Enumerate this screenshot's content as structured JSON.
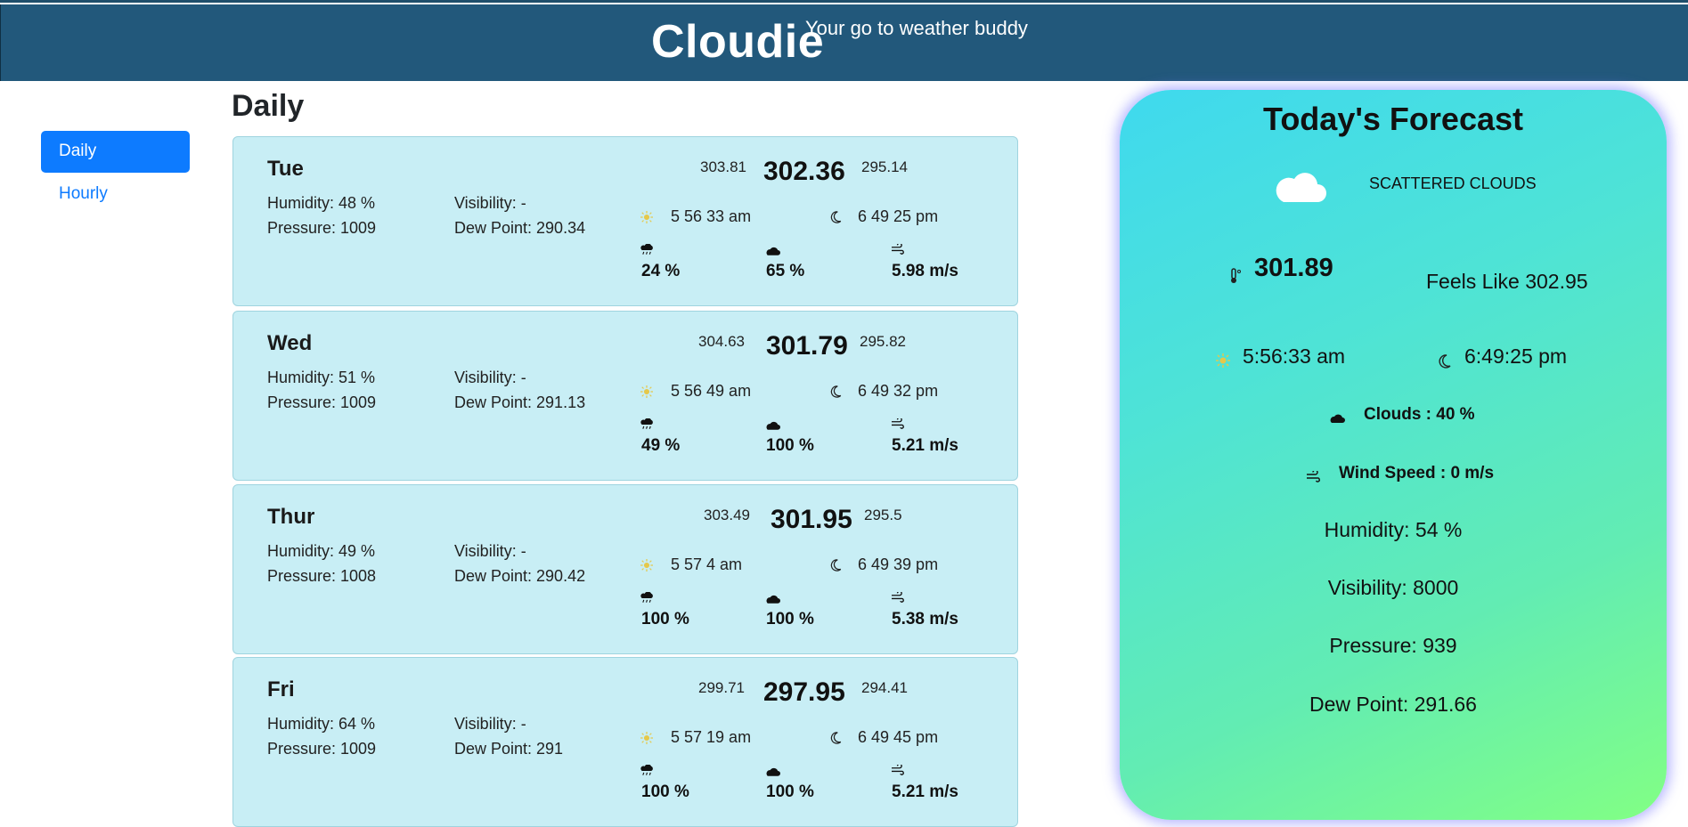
{
  "header": {
    "brand": "Cloudie",
    "tagline": "Your go to weather buddy"
  },
  "sidebar": {
    "items": [
      {
        "label": "Daily",
        "active": true
      },
      {
        "label": "Hourly",
        "active": false
      }
    ]
  },
  "main": {
    "title": "Daily",
    "days": [
      {
        "day": "Tue",
        "humidity": "Humidity: 48 %",
        "pressure": "Pressure: 1009",
        "visibility": "Visibility: -",
        "dew_point": "Dew Point: 290.34",
        "temp_max": "303.81",
        "temp": "302.36",
        "temp_min": "295.14",
        "sunrise": "5 56 33 am",
        "sunset": "6 49 25 pm",
        "rain": "24 %",
        "clouds": "65 %",
        "wind": "5.98 m/s"
      },
      {
        "day": "Wed",
        "humidity": "Humidity: 51 %",
        "pressure": "Pressure: 1009",
        "visibility": "Visibility: -",
        "dew_point": "Dew Point: 291.13",
        "temp_max": "304.63",
        "temp": "301.79",
        "temp_min": "295.82",
        "sunrise": "5 56 49 am",
        "sunset": "6 49 32 pm",
        "rain": "49 %",
        "clouds": "100 %",
        "wind": "5.21 m/s"
      },
      {
        "day": "Thur",
        "humidity": "Humidity: 49 %",
        "pressure": "Pressure: 1008",
        "visibility": "Visibility: -",
        "dew_point": "Dew Point: 290.42",
        "temp_max": "303.49",
        "temp": "301.95",
        "temp_min": "295.5",
        "sunrise": "5 57 4 am",
        "sunset": "6 49 39 pm",
        "rain": "100 %",
        "clouds": "100 %",
        "wind": "5.38 m/s"
      },
      {
        "day": "Fri",
        "humidity": "Humidity: 64 %",
        "pressure": "Pressure: 1009",
        "visibility": "Visibility: -",
        "dew_point": "Dew Point: 291",
        "temp_max": "299.71",
        "temp": "297.95",
        "temp_min": "294.41",
        "sunrise": "5 57 19 am",
        "sunset": "6 49 45 pm",
        "rain": "100 %",
        "clouds": "100 %",
        "wind": "5.21 m/s"
      }
    ]
  },
  "forecast": {
    "title": "Today's Forecast",
    "condition_icon": "cloud-icon",
    "condition": "SCATTERED CLOUDS",
    "temp": "301.89",
    "feels_like": "Feels Like 302.95",
    "sunrise": "5:56:33 am",
    "sunset": "6:49:25 pm",
    "clouds": "Clouds : 40 %",
    "wind": "Wind Speed : 0 m/s",
    "humidity": "Humidity: 54 %",
    "visibility": "Visibility: 8000",
    "pressure": "Pressure: 939",
    "dew_point": "Dew Point: 291.66"
  },
  "colors": {
    "header_bg": "#22587b",
    "nav_active": "#0d7bff",
    "card_bg": "#c8eef5"
  }
}
